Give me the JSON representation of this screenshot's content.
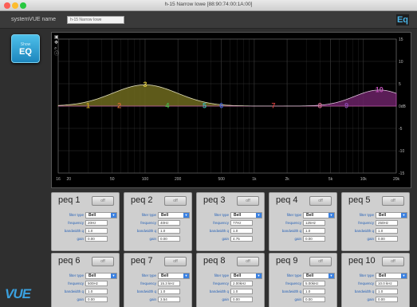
{
  "window": {
    "title": "h-15 Narrow Iowe [88:90:74:00:1A:00]",
    "traffic_colors": [
      "#fc5f57",
      "#fdbc2e",
      "#28c840"
    ]
  },
  "header": {
    "system_name_label": "systemVUE name",
    "system_name_value": "h-15 Narrow Iowe",
    "eq_logo": "Eq"
  },
  "sidebar": {
    "button_line1": "Show",
    "button_line2": "EQ"
  },
  "graph": {
    "tools": [
      "fit-icon",
      "pan-icon",
      "zoom-icon",
      "info-icon"
    ],
    "freq_ticks": [
      {
        "label": "16",
        "value": 16
      },
      {
        "label": "20",
        "value": 20
      },
      {
        "label": "50",
        "value": 50
      },
      {
        "label": "100",
        "value": 100
      },
      {
        "label": "200",
        "value": 200
      },
      {
        "label": "500",
        "value": 500
      },
      {
        "label": "1k",
        "value": 1000
      },
      {
        "label": "2k",
        "value": 2000
      },
      {
        "label": "5k",
        "value": 5000
      },
      {
        "label": "10k",
        "value": 10000
      },
      {
        "label": "20k",
        "value": 20000
      }
    ],
    "db_ticks": [
      {
        "label": "15",
        "value": 15
      },
      {
        "label": "10",
        "value": 10
      },
      {
        "label": "5",
        "value": 5
      },
      {
        "label": "0dB",
        "value": 0
      },
      {
        "label": "-5",
        "value": -5
      },
      {
        "label": "-10",
        "value": -10
      },
      {
        "label": "-15",
        "value": -15
      }
    ],
    "freq_range": [
      16,
      20000
    ],
    "db_range": [
      -15,
      15
    ],
    "curve_colors": {
      "low_fill": "#6f6a1e",
      "low_stroke": "#bdb23a",
      "high_fill": "#6b2266",
      "high_stroke": "#b04aa8"
    },
    "nodes": [
      {
        "label": "1",
        "freq": 30,
        "gain": 0,
        "color": "#c9a020"
      },
      {
        "label": "2",
        "freq": 58,
        "gain": 0,
        "color": "#d06a30"
      },
      {
        "label": "3",
        "freq": 100,
        "gain": 4.75,
        "color": "#d7c23a"
      },
      {
        "label": "4",
        "freq": 160,
        "gain": 0,
        "color": "#49b04a"
      },
      {
        "label": "5",
        "freq": 350,
        "gain": 0,
        "color": "#3ab0a8"
      },
      {
        "label": "6",
        "freq": 500,
        "gain": 0,
        "color": "#3f5fd0"
      },
      {
        "label": "7",
        "freq": 1500,
        "gain": 0,
        "color": "#c93a3a"
      },
      {
        "label": "8",
        "freq": 4000,
        "gain": 0,
        "color": "#d06a90"
      },
      {
        "label": "9",
        "freq": 7000,
        "gain": 0,
        "color": "#8a4ab0"
      },
      {
        "label": "10",
        "freq": 14000,
        "gain": 3.6,
        "color": "#c050b8"
      }
    ]
  },
  "peq_labels": {
    "filter_type": "filter type",
    "frequency": "frequency",
    "bandwidth": "bandwidth q",
    "gain": "gain",
    "toggle": "off"
  },
  "peq": [
    {
      "name": "peq 1",
      "filter_type": "Bell",
      "frequency": "20Hz",
      "bandwidth": "1.0",
      "gain": "0.00"
    },
    {
      "name": "peq 2",
      "filter_type": "Bell",
      "frequency": "40Hz",
      "bandwidth": "1.0",
      "gain": "0.00"
    },
    {
      "name": "peq 3",
      "filter_type": "Bell",
      "frequency": "77Hz",
      "bandwidth": "1.0",
      "gain": "4.75"
    },
    {
      "name": "peq 4",
      "filter_type": "Bell",
      "frequency": "125Hz",
      "bandwidth": "1.0",
      "gain": "0.00"
    },
    {
      "name": "peq 5",
      "filter_type": "Bell",
      "frequency": "250Hz",
      "bandwidth": "1.0",
      "gain": "0.00"
    },
    {
      "name": "peq 6",
      "filter_type": "Bell",
      "frequency": "500Hz",
      "bandwidth": "1.0",
      "gain": "0.00"
    },
    {
      "name": "peq 7",
      "filter_type": "Bell",
      "frequency": "15.3 kHz",
      "bandwidth": "1.0",
      "gain": "3.54"
    },
    {
      "name": "peq 8",
      "filter_type": "Bell",
      "frequency": "2.00kHz",
      "bandwidth": "1.0",
      "gain": "0.00"
    },
    {
      "name": "peq 9",
      "filter_type": "Bell",
      "frequency": "5.00kHz",
      "bandwidth": "1.0",
      "gain": "0.00"
    },
    {
      "name": "peq 10",
      "filter_type": "Bell",
      "frequency": "10.0 kHz",
      "bandwidth": "1.0",
      "gain": "0.00"
    }
  ],
  "footer": {
    "logo_text": "VUE"
  }
}
